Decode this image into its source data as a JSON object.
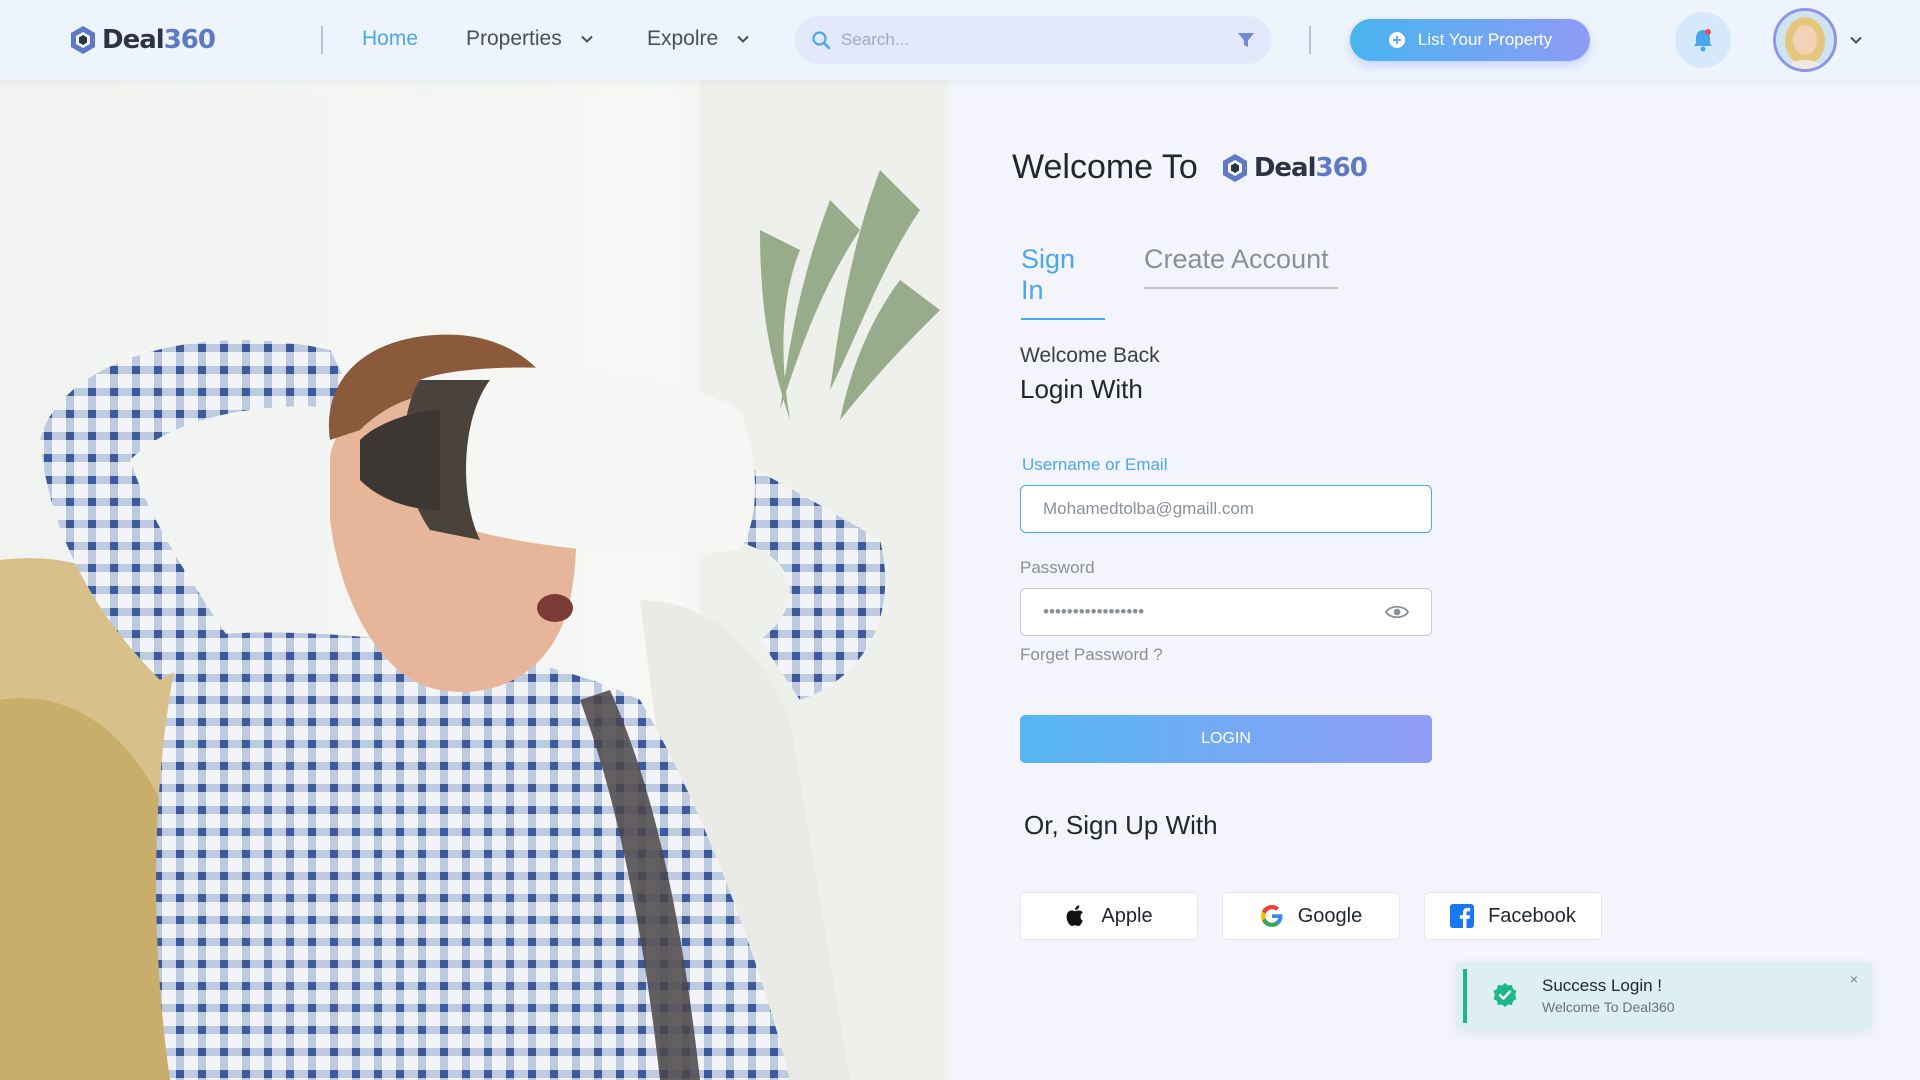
{
  "header": {
    "brand": {
      "word": "Deal",
      "number": "360"
    },
    "nav": [
      {
        "label": "Home",
        "active": true
      },
      {
        "label": "Properties",
        "has_dropdown": true
      },
      {
        "label": "Expolre",
        "has_dropdown": true
      }
    ],
    "search": {
      "placeholder": "Search...",
      "icon": "search-icon",
      "filter_icon": "filter-icon"
    },
    "list_property_label": "List Your Property",
    "notification_icon": "bell-icon",
    "avatar_icon": "user-avatar"
  },
  "photo": {
    "subject": "man-with-vr-headset",
    "icon": "hero-photo"
  },
  "auth": {
    "welcome_prefix": "Welcome To",
    "brand": {
      "word": "Deal",
      "number": "360"
    },
    "tabs": [
      {
        "label": "Sign In",
        "active": true
      },
      {
        "label": "Create Account",
        "active": false
      }
    ],
    "welcome_back": "Welcome Back",
    "login_with": "Login With",
    "username": {
      "label": "Username or Email",
      "value": "Mohamedtolba@gmaill.com"
    },
    "password": {
      "label": "Password",
      "value": "•••••••••••••••••",
      "icon": "eye-icon"
    },
    "forgot_label": "Forget Password ?",
    "login_label": "LOGIN",
    "or_label": "Or, Sign Up With",
    "social": [
      {
        "label": "Apple",
        "icon": "apple-icon"
      },
      {
        "label": "Google",
        "icon": "google-icon"
      },
      {
        "label": "Facebook",
        "icon": "facebook-icon"
      }
    ]
  },
  "toast": {
    "title": "Success Login !",
    "message": "Welcome To Deal360",
    "close": "×",
    "icon": "check-circle-icon"
  },
  "colors": {
    "accent": "#4aa7ea",
    "gradient_start": "#48b4f0",
    "gradient_end": "#8e9bf6",
    "success": "#1bb88a",
    "background": "#f3f4fc"
  }
}
